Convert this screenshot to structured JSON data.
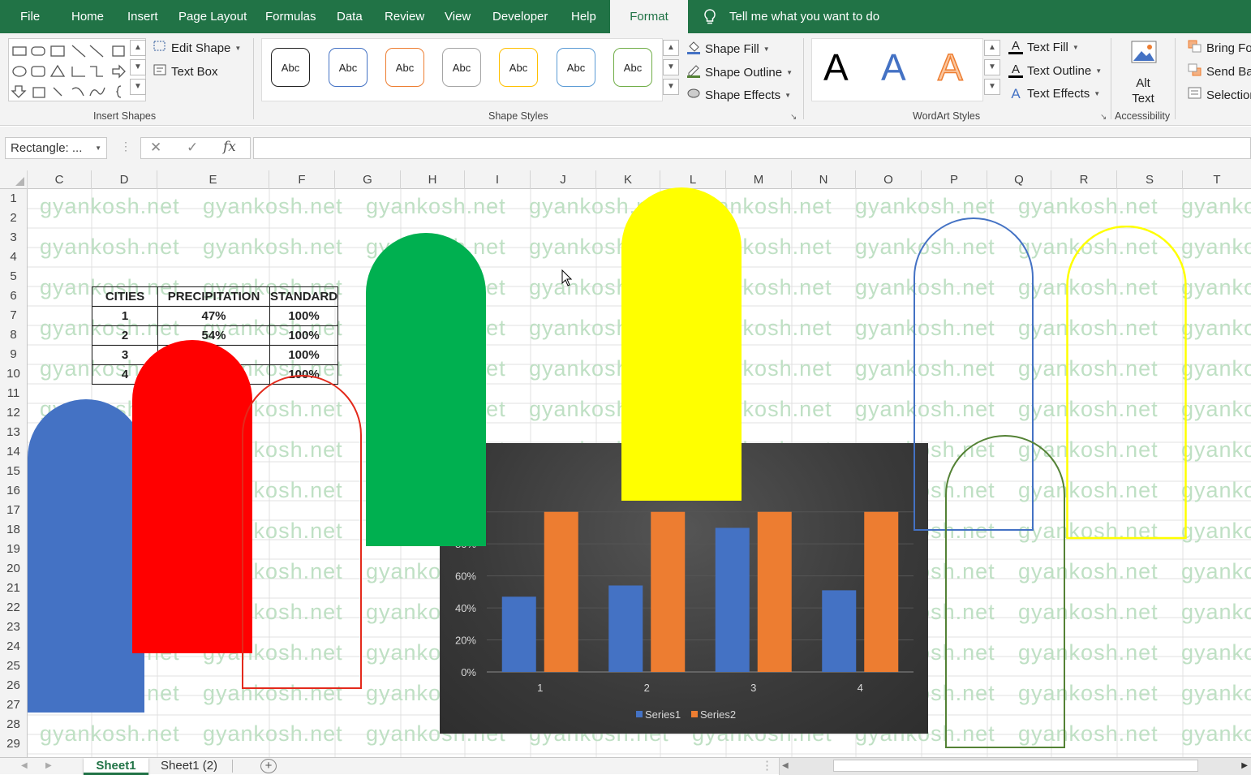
{
  "menu": {
    "tabs": [
      "File",
      "Home",
      "Insert",
      "Page Layout",
      "Formulas",
      "Data",
      "Review",
      "View",
      "Developer",
      "Help",
      "Format"
    ],
    "active_tab": "Format",
    "tell_me": "Tell me what you want to do"
  },
  "ribbon": {
    "insert_shapes": {
      "label": "Insert Shapes",
      "edit_shape": "Edit Shape",
      "text_box": "Text Box"
    },
    "shape_styles": {
      "label": "Shape Styles",
      "preset_text": "Abc",
      "shape_fill": "Shape Fill",
      "shape_outline": "Shape Outline",
      "shape_effects": "Shape Effects"
    },
    "wordart_styles": {
      "label": "WordArt Styles",
      "letter": "A",
      "text_fill": "Text Fill",
      "text_outline": "Text Outline",
      "text_effects": "Text Effects"
    },
    "accessibility": {
      "label": "Accessibility",
      "alt_text_line1": "Alt",
      "alt_text_line2": "Text"
    },
    "arrange": {
      "bring_forward": "Bring Fo",
      "send_backward": "Send Ba",
      "selection": "Selection"
    }
  },
  "formula_bar": {
    "name_box": "Rectangle: ...",
    "cancel": "✕",
    "enter": "✓",
    "fx": "fx",
    "value": ""
  },
  "columns": [
    "C",
    "D",
    "E",
    "F",
    "G",
    "H",
    "I",
    "J",
    "K",
    "L",
    "M",
    "N",
    "O",
    "P",
    "Q",
    "R",
    "S",
    "T"
  ],
  "rows": [
    "1",
    "2",
    "3",
    "4",
    "5",
    "6",
    "7",
    "8",
    "9",
    "10",
    "11",
    "12",
    "13",
    "14",
    "15",
    "16",
    "17",
    "18",
    "19",
    "20",
    "21",
    "22",
    "23",
    "24",
    "25",
    "26",
    "27",
    "28",
    "29"
  ],
  "watermark": "gyankosh.net",
  "table": {
    "headers": [
      "CITIES",
      "PRECIPITATION",
      "STANDARD"
    ],
    "rows": [
      [
        "1",
        "47%",
        "100%"
      ],
      [
        "2",
        "54%",
        "100%"
      ],
      [
        "3",
        "",
        "100%"
      ],
      [
        "4",
        "",
        "100%"
      ]
    ]
  },
  "shapes": [
    {
      "name": "blue-filled-arch",
      "fill": "#4472c4",
      "outline": "none"
    },
    {
      "name": "red-filled-arch",
      "fill": "#ff0000",
      "outline": "none"
    },
    {
      "name": "red-outline-arch",
      "fill": "none",
      "outline": "#e32a1c"
    },
    {
      "name": "green-filled-arch",
      "fill": "#00b050",
      "outline": "none"
    },
    {
      "name": "yellow-filled-arch",
      "fill": "#ffff00",
      "outline": "none"
    },
    {
      "name": "blue-outline-arch",
      "fill": "none",
      "outline": "#4472c4"
    },
    {
      "name": "yellow-outline-arch",
      "fill": "none",
      "outline": "#ffff00"
    },
    {
      "name": "green-outline-arch",
      "fill": "none",
      "outline": "#548235"
    }
  ],
  "chart_data": {
    "type": "bar",
    "categories": [
      "1",
      "2",
      "3",
      "4"
    ],
    "series": [
      {
        "name": "Series1",
        "values": [
          0.47,
          0.54,
          0.9,
          0.51
        ],
        "color": "#4472c4"
      },
      {
        "name": "Series2",
        "values": [
          1.0,
          1.0,
          1.0,
          1.0
        ],
        "color": "#ed7d31"
      }
    ],
    "yticks": [
      "0%",
      "20%",
      "40%",
      "60%",
      "80%"
    ],
    "ylim": [
      0,
      1.1
    ],
    "legend": "bottom",
    "background": "#3d3d3d"
  },
  "sheets": {
    "tabs": [
      "Sheet1",
      "Sheet1 (2)"
    ],
    "active": "Sheet1",
    "add": "+"
  }
}
